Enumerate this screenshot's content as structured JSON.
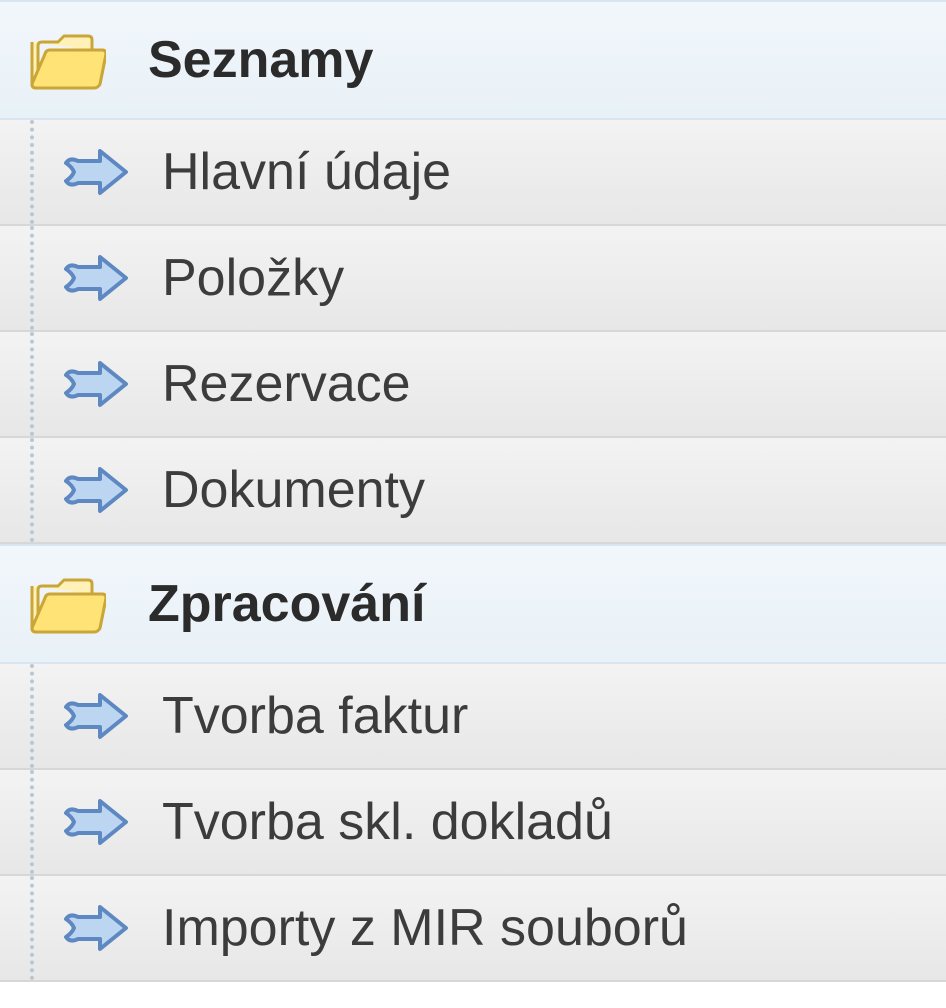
{
  "groups": [
    {
      "id": "seznamy",
      "title": "Seznamy",
      "items": [
        {
          "id": "hlavni-udaje",
          "label": "Hlavní údaje"
        },
        {
          "id": "polozky",
          "label": "Položky"
        },
        {
          "id": "rezervace",
          "label": "Rezervace"
        },
        {
          "id": "dokumenty",
          "label": "Dokumenty"
        }
      ]
    },
    {
      "id": "zpracovani",
      "title": "Zpracování",
      "items": [
        {
          "id": "tvorba-faktur",
          "label": "Tvorba faktur"
        },
        {
          "id": "tvorba-skl-dokladu",
          "label": "Tvorba skl. dokladů"
        },
        {
          "id": "importy-mir",
          "label": "Importy z MIR souborů"
        }
      ]
    }
  ],
  "icons": {
    "folder": "folder-open-icon",
    "arrow": "arrow-right-icon"
  }
}
